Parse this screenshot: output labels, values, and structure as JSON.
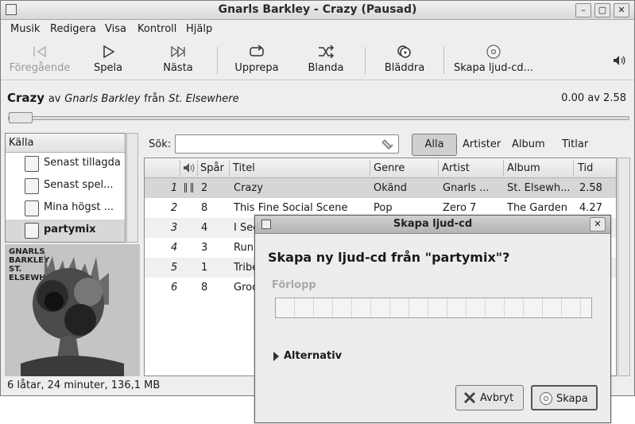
{
  "window": {
    "title": "Gnarls Barkley - Crazy (Pausad)"
  },
  "menu": [
    "Musik",
    "Redigera",
    "Visa",
    "Kontroll",
    "Hjälp"
  ],
  "toolbar": {
    "previous": "Föregående",
    "play": "Spela",
    "next": "Nästa",
    "repeat": "Upprepa",
    "shuffle": "Blanda",
    "browse": "Bläddra",
    "create_cd": "Skapa ljud-cd..."
  },
  "now_playing": {
    "title": "Crazy",
    "by": "av",
    "artist": "Gnarls Barkley",
    "from": "från",
    "album": "St. Elsewhere",
    "position": "0.00 av 2.58",
    "progress": 0
  },
  "source": {
    "header": "Källa",
    "items": [
      "Senast tillagda",
      "Senast spel...",
      "Mina högst ...",
      "partymix"
    ],
    "selected_index": 3,
    "cover_text": [
      "GNARLS",
      "BARKLEY",
      "ST.",
      "ELSEWHERE"
    ]
  },
  "search": {
    "label": "Sök:",
    "value": ""
  },
  "filters": [
    "Alla",
    "Artister",
    "Album",
    "Titlar"
  ],
  "table": {
    "headers": [
      "Spår",
      "Titel",
      "Genre",
      "Artist",
      "Album",
      "Tid"
    ],
    "rows": [
      [
        "1",
        "2",
        "Crazy",
        "Okänd",
        "Gnarls ...",
        "St. Elsewh...",
        "2.58"
      ],
      [
        "2",
        "8",
        "This Fine Social Scene",
        "Pop",
        "Zero 7",
        "The Garden",
        "4.27"
      ],
      [
        "3",
        "4",
        "I See",
        "",
        "",
        "",
        ""
      ],
      [
        "4",
        "3",
        "Run",
        "",
        "",
        "",
        ""
      ],
      [
        "5",
        "1",
        "Tribe",
        "",
        "",
        "",
        ""
      ],
      [
        "6",
        "8",
        "Groo",
        "",
        "",
        "",
        ""
      ]
    ]
  },
  "status_bar": "6 låtar, 24 minuter, 136,1 MB",
  "dialog": {
    "title": "Skapa ljud-cd",
    "heading": "Skapa ny ljud-cd från \"partymix\"?",
    "progress_label": "Förlopp",
    "progress": 0,
    "expander": "Alternativ",
    "cancel": "Avbryt",
    "create": "Skapa"
  }
}
